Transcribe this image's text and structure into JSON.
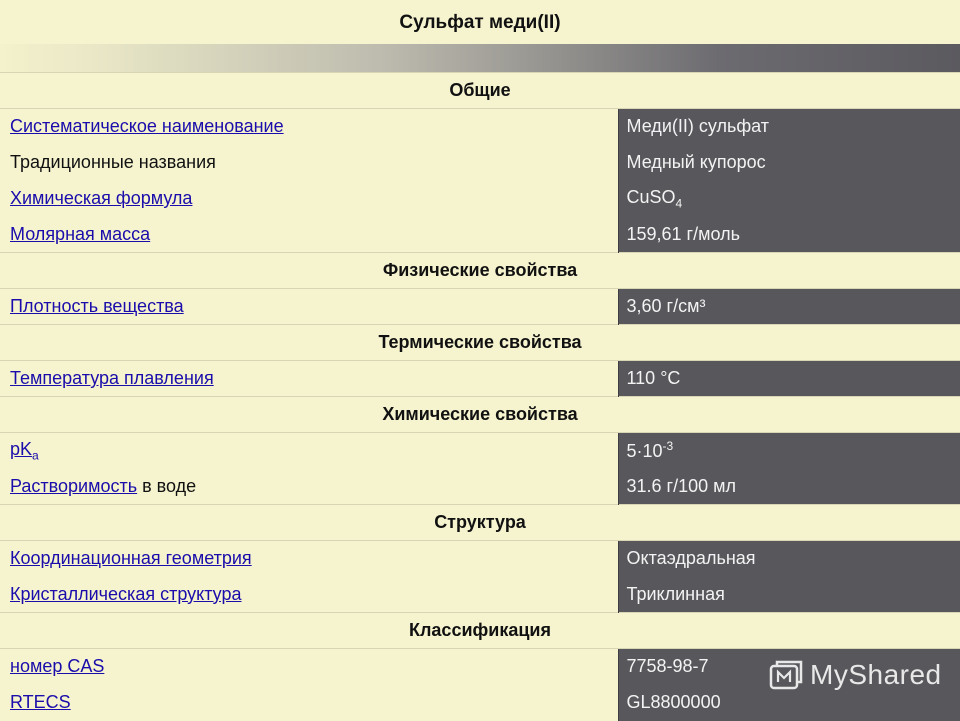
{
  "title": "Сульфат меди(II)",
  "sections": {
    "general": "Общие",
    "physical": "Физические свойства",
    "thermal": "Термические свойства",
    "chemical": "Химические свойства",
    "structure": "Структура",
    "classification": "Классификация"
  },
  "rows": {
    "systematic_name": {
      "label": "Систематическое наименование",
      "value": "Меди(II) сульфат"
    },
    "traditional_names": {
      "label": "Традиционные названия",
      "value": "Медный купорос"
    },
    "formula": {
      "label": "Химическая формула",
      "value_main": "CuSO",
      "value_sub": "4"
    },
    "molar_mass": {
      "label": "Молярная масса",
      "value": "159,61 г/моль"
    },
    "density": {
      "label": "Плотность вещества",
      "value": "3,60 г/см³"
    },
    "melting_point": {
      "label": "Температура плавления",
      "value": "110 °C"
    },
    "pka": {
      "label_main": "pK",
      "label_sub": "a",
      "value_main": "5·10",
      "value_sup": "-3"
    },
    "solubility": {
      "label_link": "Растворимость",
      "label_rest": " в воде",
      "value": "31.6 г/100 мл"
    },
    "coordination": {
      "label": "Координационная геометрия",
      "value": "Октаэдральная"
    },
    "crystal": {
      "label": "Кристаллическая структура",
      "value": "Триклинная"
    },
    "cas": {
      "label": "номер CAS",
      "value": "7758-98-7"
    },
    "rtecs": {
      "label": "RTECS",
      "value": "GL8800000"
    }
  },
  "watermark": {
    "text": "MyShared",
    "icon": "myshared-logo-icon"
  }
}
